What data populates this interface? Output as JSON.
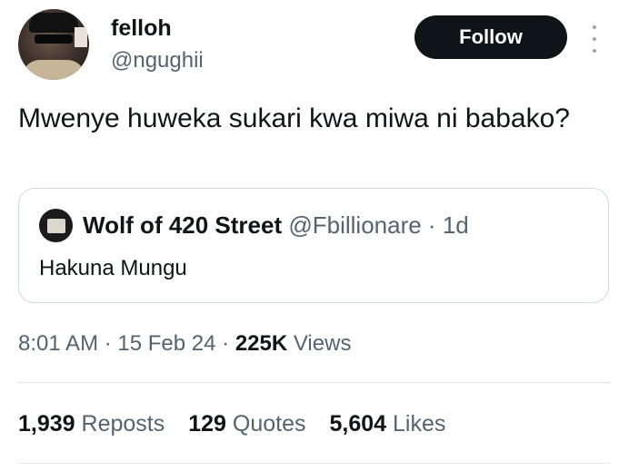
{
  "author": {
    "display_name": "felloh",
    "handle": "@ngughii"
  },
  "follow_button": {
    "label": "Follow"
  },
  "tweet": {
    "text": "Mwenye huweka sukari kwa miwa ni babako?"
  },
  "quoted": {
    "display_name": "Wolf of 420 Street",
    "handle": "@Fbillionare",
    "separator": " · ",
    "age": "1d",
    "text": "Hakuna Mungu"
  },
  "meta": {
    "time": "8:01 AM",
    "date": "15 Feb 24",
    "views_count": "225K",
    "views_label": "Views",
    "separator": " · "
  },
  "stats": {
    "reposts_count": "1,939",
    "reposts_label": "Reposts",
    "quotes_count": "129",
    "quotes_label": "Quotes",
    "likes_count": "5,604",
    "likes_label": "Likes"
  },
  "colors": {
    "text_primary": "#0f1419",
    "text_secondary": "#536471",
    "button_bg": "#0f1419",
    "border": "#cfd9de"
  },
  "icons": {
    "more": "more-vertical-icon"
  }
}
